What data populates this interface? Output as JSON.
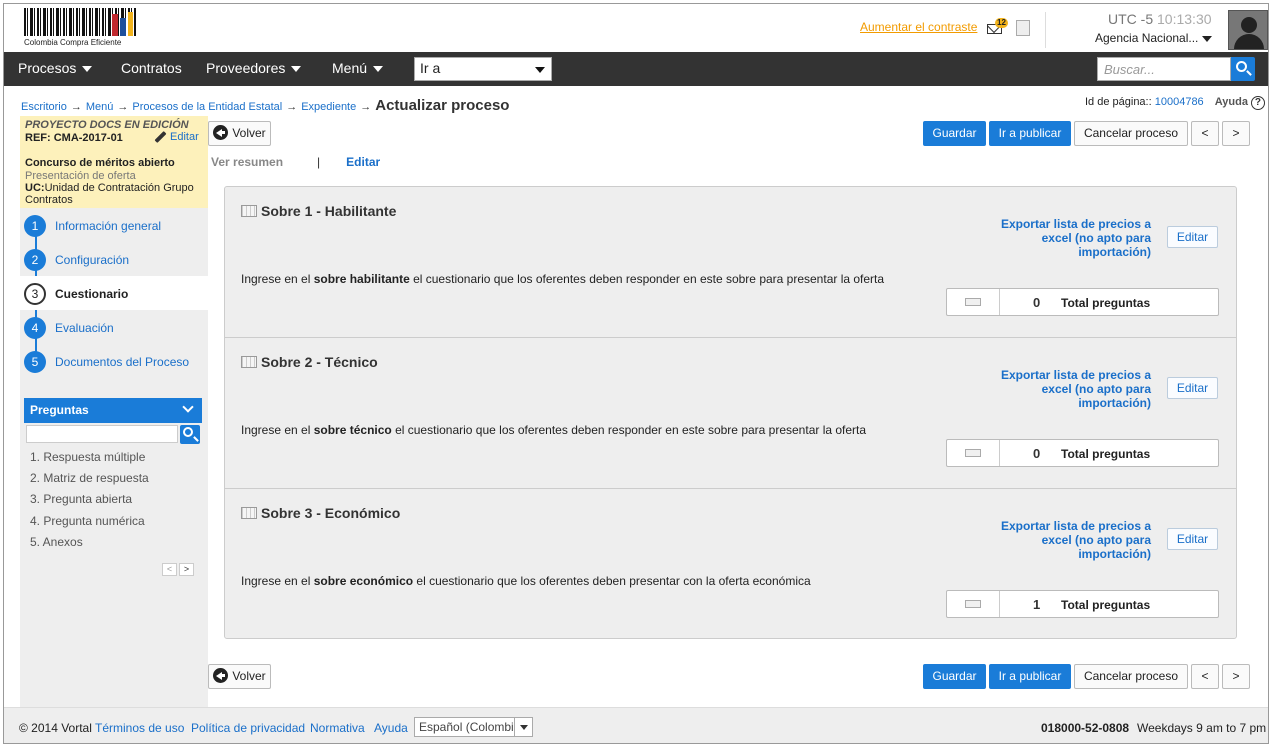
{
  "header": {
    "logo_text": "Colombia Compra Eficiente",
    "contrast_link": "Aumentar el contraste",
    "mail_count": "12",
    "utc_label": "UTC -5",
    "time": "10:13:30",
    "agency": "Agencia Nacional..."
  },
  "nav": {
    "items": [
      "Procesos",
      "Contratos",
      "Proveedores",
      "Menú"
    ],
    "goto_value": "Ir a",
    "search_placeholder": "Buscar..."
  },
  "breadcrumb": {
    "items": [
      "Escritorio",
      "Menú",
      "Procesos de la Entidad Estatal",
      "Expediente"
    ],
    "current": "Actualizar proceso",
    "page_id_label": "Id de página::",
    "page_id": "10004786",
    "help": "Ayuda"
  },
  "project": {
    "status": "PROYECTO DOCS EN EDICIÓN",
    "ref": "REF: CMA-2017-01",
    "edit": "Editar",
    "type": "Concurso de méritos abierto",
    "phase": "Presentación de oferta",
    "uc_label": "UC:",
    "uc_value": "Unidad de Contratación Grupo Contratos"
  },
  "steps": [
    {
      "num": "1",
      "label": "Información general"
    },
    {
      "num": "2",
      "label": "Configuración"
    },
    {
      "num": "3",
      "label": "Cuestionario"
    },
    {
      "num": "4",
      "label": "Evaluación"
    },
    {
      "num": "5",
      "label": "Documentos del Proceso"
    }
  ],
  "preguntas": {
    "title": "Preguntas",
    "items": [
      "1. Respuesta múltiple",
      "2. Matriz de respuesta",
      "3. Pregunta abierta",
      "4. Pregunta numérica",
      "5. Anexos"
    ],
    "pager_prev": "<",
    "pager_next": ">"
  },
  "toolbar": {
    "back": "Volver",
    "save": "Guardar",
    "publish": "Ir a publicar",
    "cancel": "Cancelar proceso",
    "prev": "<",
    "next": ">"
  },
  "tabs": {
    "summary": "Ver resumen",
    "separator": "|",
    "edit": "Editar"
  },
  "sobres": [
    {
      "title": "Sobre 1 - Habilitante",
      "export": "Exportar lista de precios a excel (no apto para importación)",
      "edit": "Editar",
      "desc_pre": "Ingrese en el ",
      "desc_bold": "sobre habilitante",
      "desc_post": " el cuestionario que los oferentes deben responder en este sobre para presentar la oferta",
      "count": "0",
      "count_label": "Total preguntas"
    },
    {
      "title": "Sobre 2 - Técnico",
      "export": "Exportar lista de precios a excel (no apto para importación)",
      "edit": "Editar",
      "desc_pre": "Ingrese en el ",
      "desc_bold": "sobre técnico",
      "desc_post": " el cuestionario que los oferentes deben responder en este sobre para presentar la oferta",
      "count": "0",
      "count_label": "Total preguntas"
    },
    {
      "title": "Sobre 3 - Económico",
      "export": "Exportar lista de precios a excel (no apto para importación)",
      "edit": "Editar",
      "desc_pre": "Ingrese en el ",
      "desc_bold": "sobre económico",
      "desc_post": " el cuestionario que los oferentes deben presentar con la oferta económica",
      "count": "1",
      "count_label": "Total preguntas"
    }
  ],
  "footer": {
    "copyright": "© 2014 Vortal",
    "links": [
      "Términos de uso",
      "Política de privacidad",
      "Normativa",
      "Ayuda"
    ],
    "language": "Español (Colombia)",
    "phone": "018000-52-0808",
    "hours": "Weekdays 9 am to 7 pm"
  },
  "colors": {
    "accent": "#1a7cd8",
    "nav_bg": "#333333",
    "project_bg": "#fdf1bb",
    "contrast_link": "#f29b00"
  }
}
